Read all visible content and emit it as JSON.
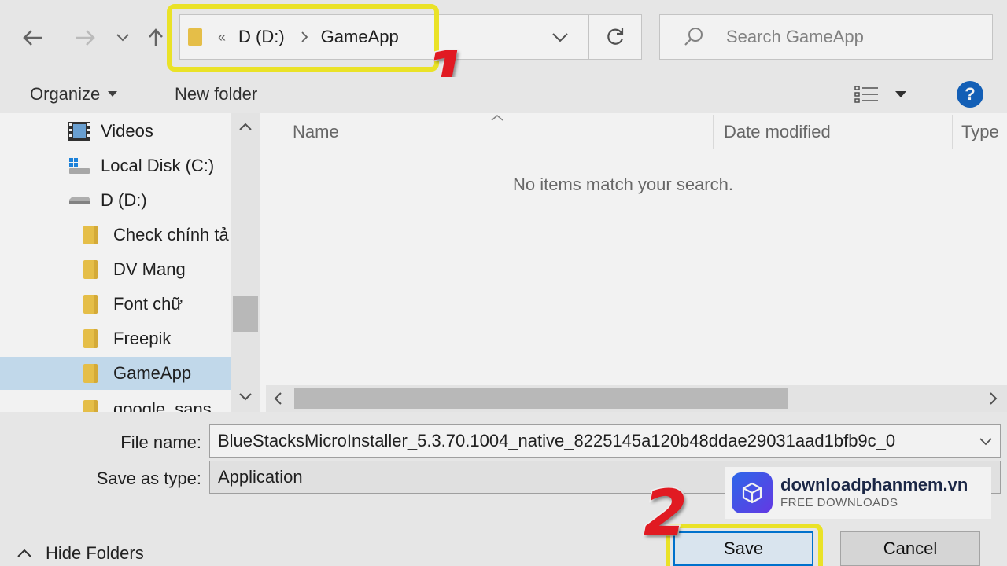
{
  "navbar": {
    "back_icon": "arrow-left-icon",
    "forward_icon": "arrow-right-icon",
    "recent_icon": "chevron-down-icon",
    "up_icon": "arrow-up-icon",
    "address": {
      "overflow": "«",
      "segments": [
        "D (D:)",
        "GameApp"
      ]
    },
    "search_placeholder": "Search GameApp"
  },
  "toolbar": {
    "organize_label": "Organize",
    "new_folder_label": "New folder",
    "help_label": "?"
  },
  "sidebar": {
    "items": [
      {
        "label": "Videos",
        "icon": "video-icon"
      },
      {
        "label": "Local Disk (C:)",
        "icon": "drive-icon"
      },
      {
        "label": "D (D:)",
        "icon": "drive-icon"
      },
      {
        "label": "Check chính tả",
        "icon": "folder-icon"
      },
      {
        "label": "DV Mang",
        "icon": "folder-icon"
      },
      {
        "label": "Font chữ",
        "icon": "folder-icon"
      },
      {
        "label": "Freepik",
        "icon": "folder-icon"
      },
      {
        "label": "GameApp",
        "icon": "folder-icon",
        "selected": true
      },
      {
        "label": "google_sans",
        "icon": "folder-icon"
      }
    ]
  },
  "content": {
    "columns": [
      "Name",
      "Date modified",
      "Type"
    ],
    "empty_message": "No items match your search."
  },
  "form": {
    "file_name_label": "File name:",
    "file_name_value": "BlueStacksMicroInstaller_5.3.70.1004_native_8225145a120b48ddae29031aad1bfb9c_0",
    "save_type_label": "Save as type:",
    "save_type_value": "Application"
  },
  "footer": {
    "hide_folders_label": "Hide Folders",
    "save_label": "Save",
    "cancel_label": "Cancel"
  },
  "annotations": {
    "step1": "1",
    "step2": "2",
    "highlight_color": "#f7ef2a",
    "number_color": "#ee1c24"
  },
  "watermark": {
    "title": "downloadphanmem.vn",
    "subtitle": "FREE DOWNLOADS"
  }
}
